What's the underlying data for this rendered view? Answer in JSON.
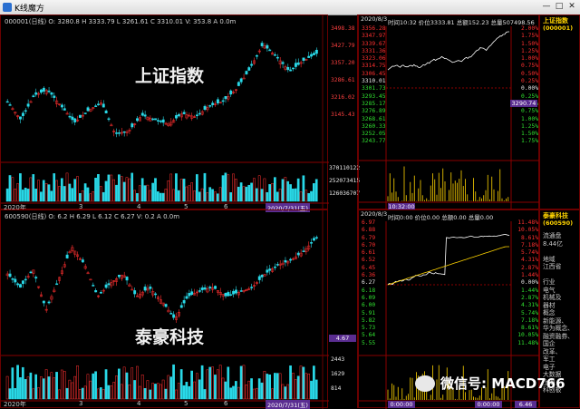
{
  "window": {
    "title": "K线魔方",
    "minimize": "—",
    "maximize": "□",
    "close": "✕"
  },
  "top_chart": {
    "info": "000001(日线)  O: 3280.8 H 3333.79 L 3261.61 C 3310.01 V: 353.8 A 0.0m",
    "name": "上证指数",
    "price_ticks": [
      "3498.38",
      "3427.79",
      "3357.20",
      "3286.61",
      "3216.02",
      "3145.43"
    ],
    "vol_ticks": [
      "370110122",
      "252073415",
      "126036707"
    ],
    "date_labels": [
      "2020年",
      "3",
      "4",
      "5",
      "6",
      "2020/7/31(五)"
    ]
  },
  "top_intraday": {
    "date": "2020/8/3",
    "header": "时间10:32 价位3333.81 总额152.23 总量507498.56",
    "left_prices": [
      "3356.28",
      "3347.97",
      "3339.67",
      "3331.36",
      "3323.06",
      "3314.75",
      "3306.45",
      "3310.01",
      "3301.73",
      "3293.45",
      "3285.17",
      "3276.89",
      "3268.61",
      "3260.33",
      "3252.05",
      "3243.77"
    ],
    "right_pcts": [
      "2.00%",
      "1.75%",
      "1.50%",
      "1.25%",
      "1.00%",
      "0.75%",
      "0.50%",
      "0.25%",
      "0.00%",
      "0.25%",
      "0.50%",
      "0.75%",
      "1.00%",
      "1.25%",
      "1.50%",
      "1.75%"
    ],
    "current_box": "3290.74",
    "time_label": "10:32:00"
  },
  "top_side": {
    "name": "上证指数",
    "code": "(000001)"
  },
  "bottom_chart": {
    "info": "600590(日线)  O: 6.2 H 6.29 L 6.12 C 6.27 V: 0.2 A 0.0m",
    "name": "泰豪科技",
    "price_box": "4.67",
    "vol_ticks": [
      "2443",
      "1629",
      "814"
    ],
    "date_labels": [
      "2020年",
      "3",
      "4",
      "5",
      "6",
      "2020/7/31(五)"
    ]
  },
  "bottom_intraday": {
    "date": "2020/8/3",
    "header": "时间0:00 价位0.00 总额0.00 总量0.00",
    "left_prices": [
      "6.97",
      "6.88",
      "6.79",
      "6.70",
      "6.61",
      "6.52",
      "6.45",
      "6.36",
      "6.27",
      "6.18",
      "6.09",
      "6.00",
      "5.91",
      "5.82",
      "5.73",
      "5.64",
      "5.55"
    ],
    "right_pcts": [
      "11.48%",
      "10.05%",
      "8.61%",
      "7.18%",
      "5.74%",
      "4.31%",
      "2.87%",
      "1.44%",
      "0.00%",
      "1.44%",
      "2.87%",
      "4.31%",
      "5.74%",
      "7.18%",
      "8.61%",
      "10.05%",
      "11.48%"
    ],
    "current_box": "6.46",
    "time_label_left": "0:00:00",
    "time_label_right": "0:00:00"
  },
  "bottom_side": {
    "name": "泰豪科技",
    "code": "(600590)",
    "lines": [
      "流通盘",
      "8.44亿",
      "",
      "地域",
      "江西省",
      "",
      "行业",
      "电气",
      "机械及",
      "器材",
      "概念",
      "新能源、",
      "华为概念、",
      "融资融券、",
      "国企",
      "改革、",
      "军工",
      "电子",
      "大数据",
      "上海",
      "科创板"
    ]
  },
  "watermark": {
    "text": "微信号: MACD766"
  },
  "colors": {
    "up": "#ff3030",
    "down": "#29d9e8",
    "axis": "#8a0000",
    "yellow": "#ffd400",
    "purple": "#5a2d91"
  }
}
